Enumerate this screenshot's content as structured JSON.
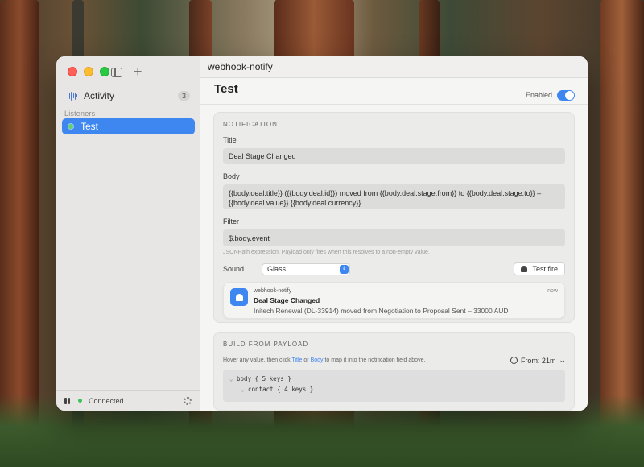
{
  "sidebar": {
    "activity": {
      "label": "Activity",
      "count": "3"
    },
    "section_label": "Listeners",
    "listeners": [
      {
        "label": "Test"
      }
    ],
    "footer": {
      "status": "Connected"
    }
  },
  "main": {
    "title": "webhook-notify",
    "page_title": "Test",
    "enabled_label": "Enabled",
    "notification": {
      "heading": "NOTIFICATION",
      "title_label": "Title",
      "title_value": "Deal Stage Changed",
      "body_label": "Body",
      "body_value": "{{body.deal.title}} ({{body.deal.id}}) moved from {{body.deal.stage.from}} to {{body.deal.stage.to}} – {{body.deal.value}} {{body.deal.currency}}",
      "filter_label": "Filter",
      "filter_value": "$.body.event",
      "filter_hint": "JSONPath expression. Payload only fires when this resolves to a non-empty value.",
      "sound_label": "Sound",
      "sound_value": "Glass",
      "test_fire_label": "Test fire",
      "preview": {
        "app": "webhook-notify",
        "title": "Deal Stage Changed",
        "body": "Initech Renewal (DL-33914) moved from Negotiation to Proposal Sent – 33000 AUD",
        "time": "now"
      }
    },
    "build": {
      "heading": "BUILD FROM PAYLOAD",
      "hint_pre": "Hover any value, then click ",
      "hint_title": "Title",
      "hint_mid": " or ",
      "hint_body": "Body",
      "hint_post": " to map it into the notification field above.",
      "from_label": "From: 21m",
      "tree": [
        {
          "key": "body",
          "summary": "{ 5 keys }"
        },
        {
          "key": "contact",
          "summary": "{ 4 keys }"
        }
      ]
    }
  },
  "colors": {
    "accent": "#3f87f0",
    "connected": "#3ac35a"
  }
}
